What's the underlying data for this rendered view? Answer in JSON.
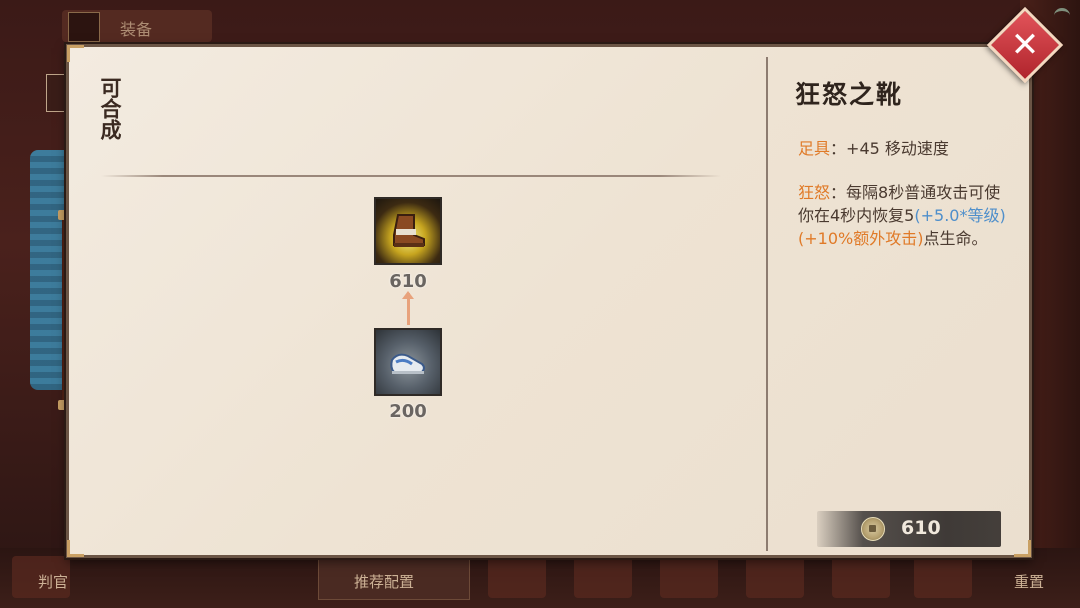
{
  "background": {
    "top_tab_label": "装备",
    "bottom_left_label": "判官",
    "recommend_label": "推荐配置",
    "reset_label": "重置"
  },
  "panel": {
    "section_title": "可合成",
    "tree": {
      "result_item_price": "610",
      "component_item_price": "200"
    },
    "detail": {
      "item_name": "狂怒之靴",
      "stat_key": "足具",
      "stat_sep": "：",
      "stat_value": "+45 移动速度",
      "passive_key": "狂怒",
      "passive_sep": "：",
      "passive_text_1": "每隔8秒普通攻击可使你在4秒内恢复5",
      "passive_scale_level": "(+5.0*等级)",
      "passive_scale_attack": "(+10%额外攻击)",
      "passive_text_2": "点生命。",
      "total_price": "610"
    },
    "icons": {
      "close": "close-icon",
      "coin": "coin-icon",
      "result_item": "boots-icon",
      "component_item": "shoes-icon"
    },
    "colors": {
      "key_orange": "#e07a28",
      "scale_blue": "#4f8fcb",
      "close_red": "#c8323a"
    }
  }
}
